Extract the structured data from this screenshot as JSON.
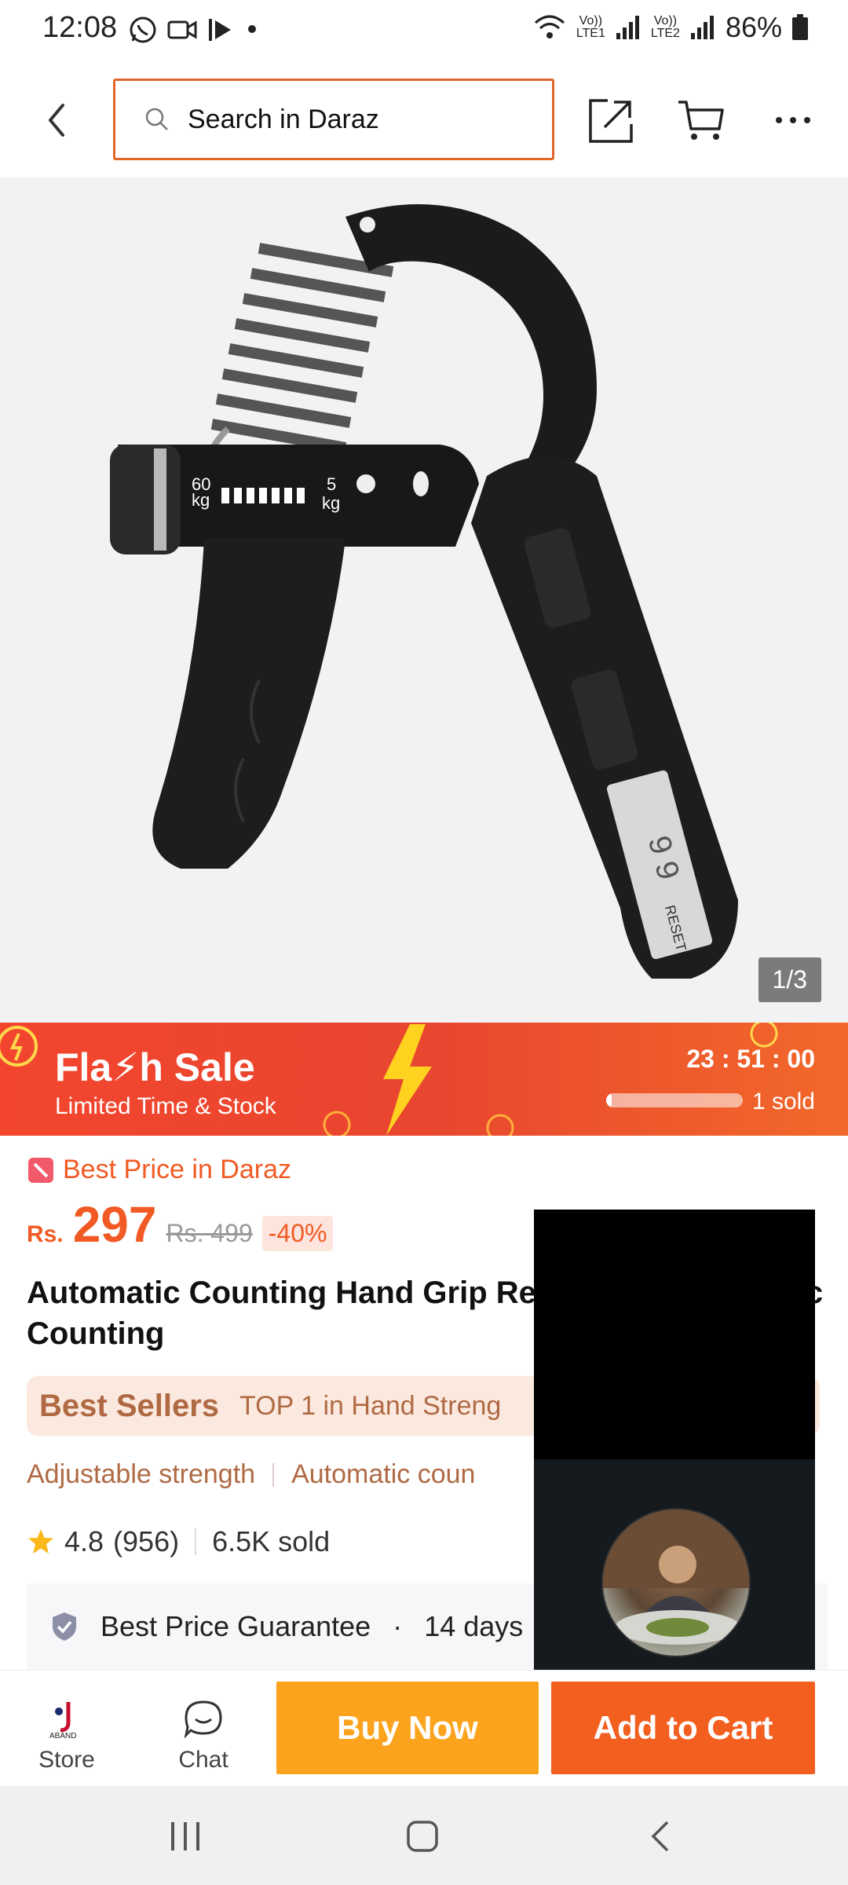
{
  "status_bar": {
    "time": "12:08",
    "battery": "86%",
    "sim1": "LTE1",
    "sim2": "LTE2",
    "volte": "Vo))"
  },
  "nav": {
    "search_placeholder": "Search in Daraz"
  },
  "gallery": {
    "counter": "1/3",
    "device_labels": {
      "max": "60",
      "min": "5",
      "unit": "kg",
      "display": "9 9",
      "reset": "RESET"
    }
  },
  "flash_sale": {
    "title": "Fla⚡h Sale",
    "subtitle": "Limited Time & Stock",
    "timer": "23 : 51 : 00",
    "sold": "1 sold",
    "sold_fraction": 0.04
  },
  "product": {
    "best_price_label": "Best Price in Daraz",
    "currency": "Rs.",
    "price": "297",
    "original_price": "Rs. 499",
    "discount": "-40%",
    "title": "Automatic Counting Hand Grip Resistance Automatic Counting",
    "best_sellers": "Best Sellers",
    "top_rank": "TOP 1 in Hand Streng",
    "tags": [
      "Adjustable strength",
      "Automatic coun"
    ],
    "rating": "4.8",
    "reviews": "(956)",
    "sold": "6.5K sold",
    "guarantee": "Best Price Guarantee",
    "guarantee_sep": "·",
    "guarantee_extra": "14 days"
  },
  "actions": {
    "store": "Store",
    "store_logo_text": "ABAND",
    "chat": "Chat",
    "buy_now": "Buy Now",
    "add_to_cart": "Add to Cart"
  },
  "colors": {
    "brand_orange": "#f15a24",
    "buy_now": "#fba31c",
    "add_cart": "#f35f1f",
    "search_border": "#e2652a"
  }
}
